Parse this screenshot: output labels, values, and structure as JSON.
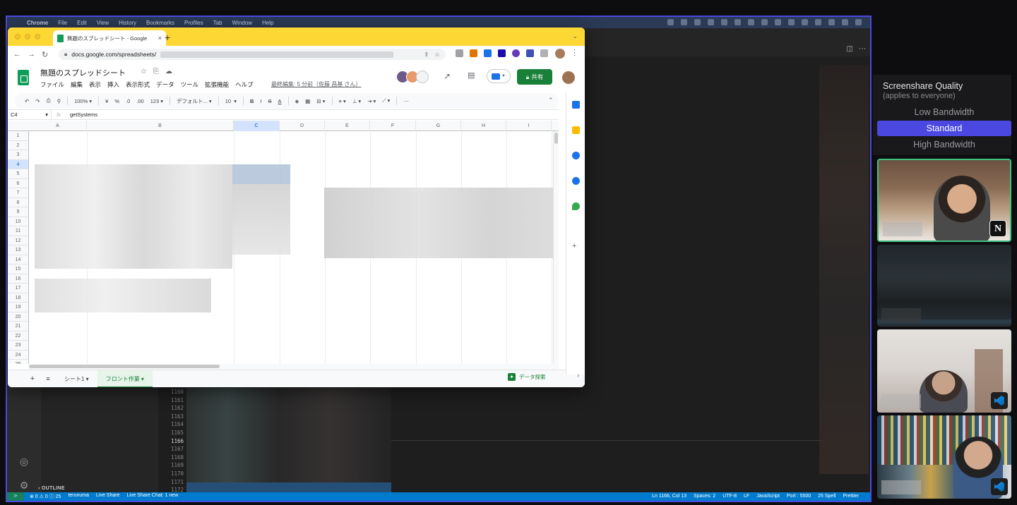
{
  "mac_menubar": {
    "apple": "",
    "items": [
      "Chrome",
      "File",
      "Edit",
      "View",
      "History",
      "Bookmarks",
      "Profiles",
      "Tab",
      "Window",
      "Help"
    ]
  },
  "chrome": {
    "tab_title": "無題のスプレッドシート - Google",
    "url": "docs.google.com/spreadsheets/",
    "new_tab": "+",
    "close_tab": "×"
  },
  "sheets": {
    "doc_title": "無題のスプレッドシート",
    "menu": [
      "ファイル",
      "編集",
      "表示",
      "挿入",
      "表示形式",
      "データ",
      "ツール",
      "拡張機能",
      "ヘルプ"
    ],
    "last_edit": "最終編集: 5 分前（佐藤 昌基 さん）",
    "share_label": "共有",
    "toolbar": {
      "zoom": "100%",
      "currency": "¥",
      "percent": "%",
      "dec_decrease": ".0",
      "dec_increase": ".00",
      "number_format": "123",
      "font": "デフォルト...",
      "font_size": "10",
      "bold": "B",
      "italic": "I",
      "strike": "S",
      "text_color": "A",
      "more": "⋯"
    },
    "name_box": "C4",
    "formula": "getSystems",
    "columns": [
      "A",
      "B",
      "C",
      "D",
      "E",
      "F",
      "G",
      "H",
      "I"
    ],
    "selected_column": "C",
    "rows": [
      "1",
      "2",
      "3",
      "4",
      "5",
      "6",
      "7",
      "8",
      "9",
      "10",
      "11",
      "12",
      "13",
      "14",
      "15",
      "16",
      "17",
      "18",
      "19",
      "20",
      "21",
      "22",
      "23",
      "24",
      "25"
    ],
    "selected_row": "4",
    "sheet_tabs": [
      {
        "label": "シート1",
        "active": false
      },
      {
        "label": "フロント作業",
        "active": true
      }
    ],
    "explore_label": "データ探索"
  },
  "editor": {
    "line_numbers": [
      "1160",
      "1161",
      "1162",
      "1163",
      "1164",
      "1165",
      "1166",
      "1167",
      "1168",
      "1169",
      "1170",
      "1171",
      "1172"
    ],
    "active_line": "1166",
    "outline_label": "OUTLINE"
  },
  "status_bar": {
    "left": [
      "⊗ 0 ⚠ 0 ⓘ 25",
      "terunuma",
      "Live Share",
      "Live Share Chat: 1 new"
    ],
    "right": [
      "Ln 1166, Col 13",
      "Spaces: 2",
      "UTF-8",
      "LF",
      "JavaScript",
      "Port : 5500",
      "25 Spell",
      "Prettier"
    ]
  },
  "quality": {
    "title": "Screenshare Quality",
    "subtitle": "(applies to everyone)",
    "options": [
      "Low Bandwidth",
      "Standard",
      "High Bandwidth"
    ],
    "selected": "Standard"
  },
  "video_tiles": {
    "badge_notion": "N"
  },
  "colors": {
    "accent": "#4a48e0",
    "active_speaker": "#3cc482",
    "sheets_green": "#188038",
    "chrome_tabstrip": "#fdd835",
    "vscode_status": "#007acc"
  }
}
